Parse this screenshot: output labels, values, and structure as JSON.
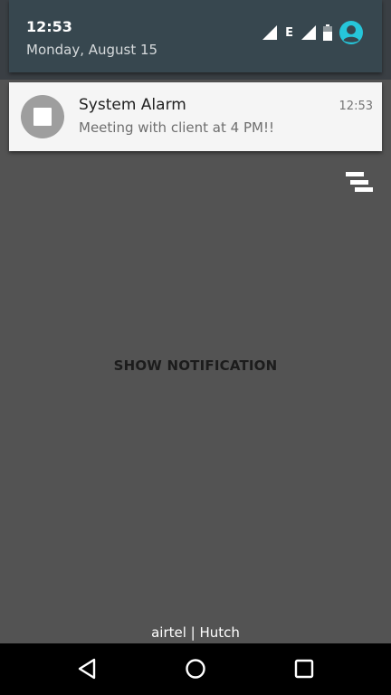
{
  "status": {
    "time": "12:53",
    "date": "Monday, August 15",
    "network_type": "E",
    "icons": [
      "signal-icon",
      "signal-icon",
      "battery-icon",
      "user-avatar-icon"
    ]
  },
  "notification": {
    "title": "System Alarm",
    "text": "Meeting with client at 4 PM!!",
    "time": "12:53",
    "icon": "stop-square-icon"
  },
  "main": {
    "show_button_label": "SHOW NOTIFICATION",
    "dismiss_icon": "clear-all-icon"
  },
  "carrier": "airtel | Hutch",
  "nav": [
    "back-icon",
    "home-icon",
    "recents-icon"
  ],
  "colors": {
    "accent": "#26c6da",
    "panel": "#37474f",
    "background": "#535353",
    "card": "#f5f5f5"
  }
}
